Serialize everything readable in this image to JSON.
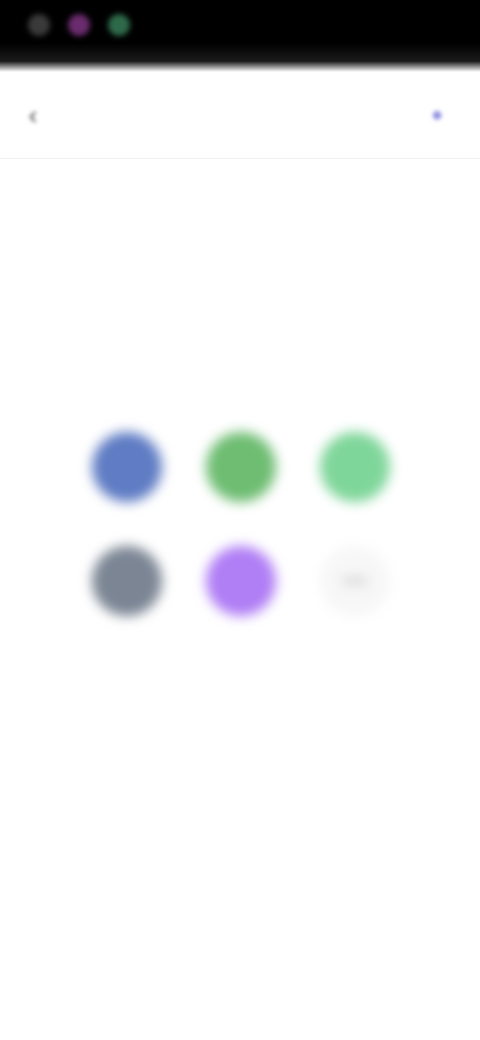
{
  "status_bar": {
    "icons": [
      "status-icon-1",
      "status-icon-2",
      "status-icon-3"
    ]
  },
  "header": {
    "back_icon": "arrow-left-icon",
    "back_glyph": "‹",
    "title": "",
    "action_icon": "action-icon",
    "action_glyph": "●"
  },
  "empty_state": {
    "circles": [
      {
        "name": "blue-circle",
        "color": "#5f7cc4"
      },
      {
        "name": "green-circle",
        "color": "#6ebd72"
      },
      {
        "name": "light-green-circle",
        "color": "#7fd69a"
      },
      {
        "name": "gray-circle",
        "color": "#7b8594"
      },
      {
        "name": "purple-circle",
        "color": "#b07ef5"
      },
      {
        "name": "empty-placeholder-circle",
        "color": "#f7f7f7"
      }
    ],
    "title": "",
    "subtitle": ""
  }
}
